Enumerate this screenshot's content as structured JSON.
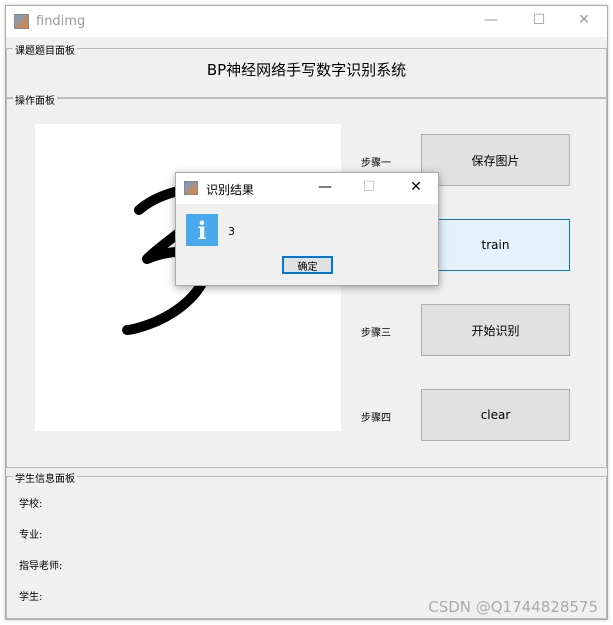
{
  "window": {
    "title": "findimg",
    "icon": "matlab-icon"
  },
  "title_panel": {
    "legend": "课题题目面板",
    "title": "BP神经网络手写数字识别系统"
  },
  "op_panel": {
    "legend": "操作面板",
    "steps": [
      {
        "label": "步骤一",
        "button": "保存图片"
      },
      {
        "label": "",
        "button": "train"
      },
      {
        "label": "步骤三",
        "button": "开始识别"
      },
      {
        "label": "步骤四",
        "button": "clear"
      }
    ]
  },
  "student_panel": {
    "legend": "学生信息面板",
    "fields": [
      "学校:",
      "专业:",
      "指导老师:",
      "学生:"
    ]
  },
  "dialog": {
    "title": "识别结果",
    "message": "3",
    "ok": "确定",
    "icon": "info-icon"
  },
  "watermark": "CSDN @Q1744828575"
}
